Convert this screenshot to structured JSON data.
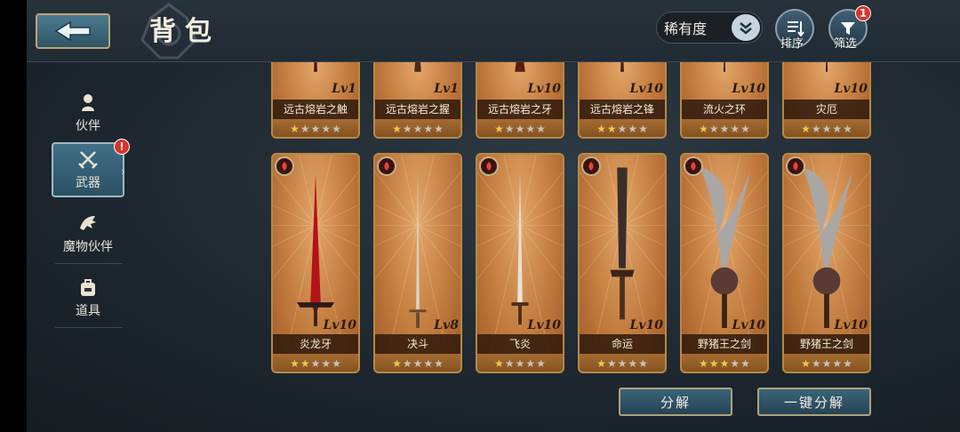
{
  "header": {
    "title": "背包",
    "rarity_select": {
      "value": "稀有度"
    },
    "sort_label": "排序",
    "filter_label": "筛选",
    "filter_badge": "1"
  },
  "sidebar": {
    "items": [
      {
        "label": "伙伴",
        "active": false
      },
      {
        "label": "武器",
        "active": true,
        "badge": "!"
      },
      {
        "label": "魔物伙伴",
        "active": false
      },
      {
        "label": "道具",
        "active": false
      }
    ]
  },
  "items_row1": [
    {
      "name": "远古熔岩之触",
      "level": "Lv1",
      "stars": 1
    },
    {
      "name": "远古熔岩之握",
      "level": "Lv1",
      "stars": 1
    },
    {
      "name": "远古熔岩之牙",
      "level": "Lv10",
      "stars": 1
    },
    {
      "name": "远古熔岩之锋",
      "level": "Lv10",
      "stars": 2
    },
    {
      "name": "流火之环",
      "level": "Lv10",
      "stars": 1
    },
    {
      "name": "灾厄",
      "level": "Lv10",
      "stars": 1
    }
  ],
  "items_row2": [
    {
      "name": "炎龙牙",
      "level": "Lv10",
      "stars": 2,
      "element": "fire"
    },
    {
      "name": "决斗",
      "level": "Lv8",
      "stars": 1,
      "element": "fire"
    },
    {
      "name": "飞炎",
      "level": "Lv10",
      "stars": 1,
      "element": "fire"
    },
    {
      "name": "命运",
      "level": "Lv10",
      "stars": 1,
      "element": "fire"
    },
    {
      "name": "野猪王之剑",
      "level": "Lv10",
      "stars": 3,
      "element": "fire"
    },
    {
      "name": "野猪王之剑",
      "level": "Lv10",
      "stars": 1,
      "element": "fire"
    }
  ],
  "actions": {
    "decompose": "分解",
    "decompose_all": "一键分解"
  },
  "colors": {
    "card_bg": "#c27b3e",
    "card_border": "#b58a45",
    "badge_red": "#d8342a",
    "star_on": "#f0c84a"
  }
}
